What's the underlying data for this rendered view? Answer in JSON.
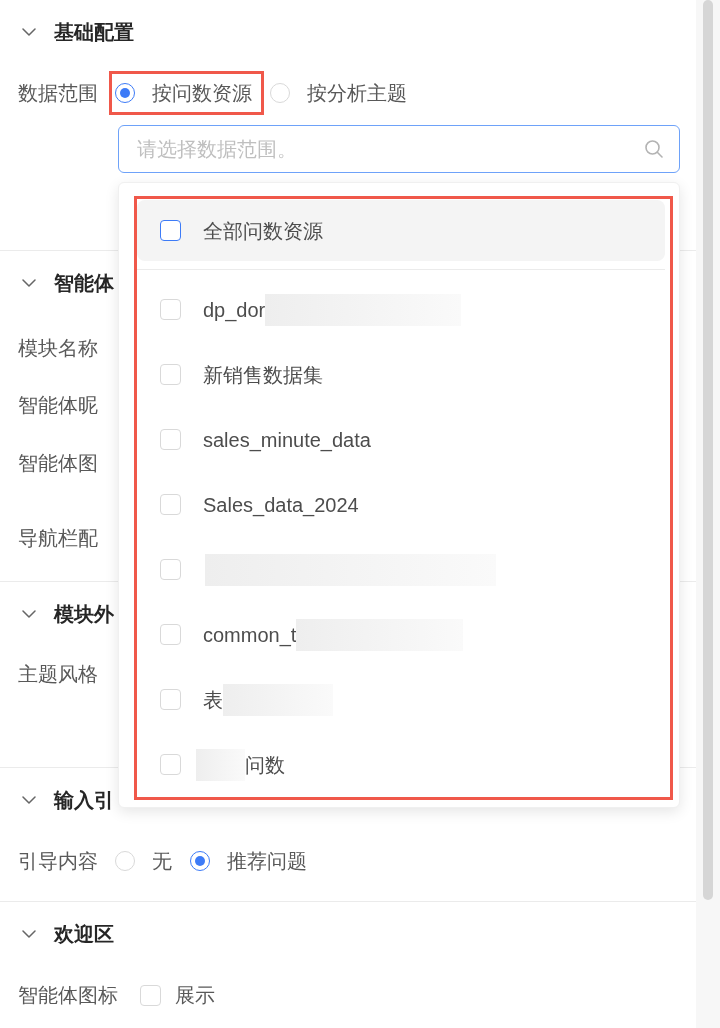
{
  "sections": [
    {
      "title": "基础配置",
      "expanded": true,
      "fields": [
        {
          "kind": "radio",
          "label": "数据范围",
          "options": [
            {
              "label": "按问数资源",
              "selected": true,
              "annotated": true
            },
            {
              "label": "按分析主题",
              "selected": false,
              "annotated": false
            }
          ],
          "search": {
            "placeholder": "请选择数据范围。",
            "focused": true
          }
        }
      ]
    },
    {
      "title": "智能体",
      "expanded": true,
      "fields": [
        {
          "kind": "text",
          "label": "模块名称"
        },
        {
          "kind": "text",
          "label": "智能体昵"
        },
        {
          "kind": "upload",
          "label": "智能体图"
        },
        {
          "kind": "text",
          "label": "导航栏配"
        }
      ]
    },
    {
      "title": "模块外",
      "expanded": true,
      "fields": [
        {
          "kind": "theme",
          "label": "主题风格"
        }
      ]
    },
    {
      "title": "输入引",
      "expanded": true,
      "fields": [
        {
          "kind": "radio",
          "label": "引导内容",
          "options": [
            {
              "label": "无",
              "selected": false,
              "annotated": false
            },
            {
              "label": "推荐问题",
              "selected": true,
              "annotated": false
            }
          ]
        }
      ]
    },
    {
      "title": "欢迎区",
      "expanded": true,
      "fields": [
        {
          "kind": "checkbox",
          "label": "智能体图标",
          "option": {
            "label": "展示",
            "checked": false
          }
        }
      ]
    }
  ],
  "dropdown": {
    "annotated": true,
    "all_option": {
      "label": "全部问数资源",
      "checked": false,
      "hovered": true
    },
    "options": [
      {
        "label": "dp_dor",
        "checked": false,
        "redacted_after": true
      },
      {
        "label": "新销售数据集",
        "checked": false
      },
      {
        "label": "sales_minute_data",
        "checked": false
      },
      {
        "label": "Sales_data_2024",
        "checked": false
      },
      {
        "checked": false,
        "redacted_before": true
      },
      {
        "label": "common_t",
        "checked": false,
        "redacted_after": true
      },
      {
        "label": "表",
        "checked": false,
        "redacted_after": true
      },
      {
        "label": "问数",
        "checked": false,
        "redacted_before": true
      }
    ]
  }
}
